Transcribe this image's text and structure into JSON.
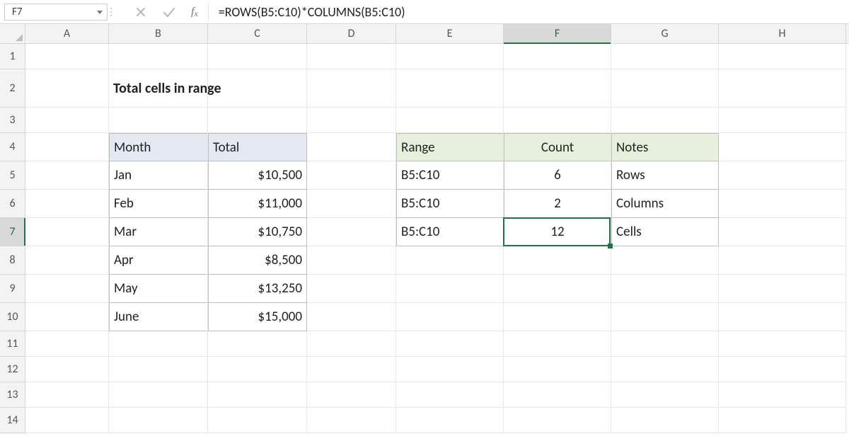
{
  "name_box": "F7",
  "formula": "=ROWS(B5:C10)*COLUMNS(B5:C10)",
  "columns": [
    "A",
    "B",
    "C",
    "D",
    "E",
    "F",
    "G",
    "H"
  ],
  "rows": [
    "1",
    "2",
    "3",
    "4",
    "5",
    "6",
    "7",
    "8",
    "9",
    "10",
    "11",
    "12",
    "13",
    "14"
  ],
  "active_col": "F",
  "active_row": "7",
  "title": "Total cells in range",
  "table1": {
    "headers": {
      "month": "Month",
      "total": "Total"
    },
    "rows": [
      {
        "month": "Jan",
        "total": "$10,500"
      },
      {
        "month": "Feb",
        "total": "$11,000"
      },
      {
        "month": "Mar",
        "total": "$10,750"
      },
      {
        "month": "Apr",
        "total": "$8,500"
      },
      {
        "month": "May",
        "total": "$13,250"
      },
      {
        "month": "June",
        "total": "$15,000"
      }
    ]
  },
  "table2": {
    "headers": {
      "range": "Range",
      "count": "Count",
      "notes": "Notes"
    },
    "rows": [
      {
        "range": "B5:C10",
        "count": "6",
        "notes": "Rows"
      },
      {
        "range": "B5:C10",
        "count": "2",
        "notes": "Columns"
      },
      {
        "range": "B5:C10",
        "count": "12",
        "notes": "Cells"
      }
    ]
  }
}
